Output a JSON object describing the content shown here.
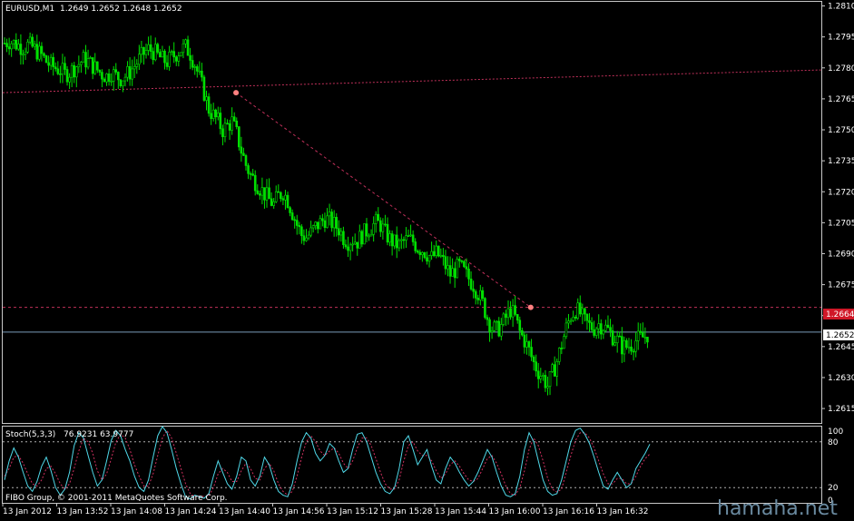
{
  "colors": {
    "background": "#000000",
    "grid": "#c8c8c8",
    "candle": "#00e000",
    "trendline": "#c0305a",
    "hline_red": "#c0305a",
    "hline_blue": "#7a9bb8",
    "stoch_main": "#4fd8e8",
    "stoch_signal": "#d03060",
    "label_red_bg": "#d01828",
    "label_white_bg": "#ffffff",
    "text": "#ffffff",
    "watermark": "#6a8aa0",
    "marker": "#ff8080"
  },
  "header": {
    "symbol": "EURUSD,M1",
    "ohlc": "1.2649 1.2652 1.2648 1.2652"
  },
  "price_labels": {
    "red_line": "1.2664",
    "current": "1.2652"
  },
  "stoch_header": {
    "name": "Stoch(5,3,3)",
    "values": "76.9231 63.9777"
  },
  "copyright": "FIBO Group, © 2001-2011 MetaQuotes Software Corp.",
  "watermark": "hamaha.net",
  "chart_data": {
    "type": "candlestick",
    "symbol": "EURUSD",
    "timeframe": "M1",
    "y_ticks": [
      "1.2810",
      "1.2795",
      "1.2780",
      "1.2765",
      "1.2750",
      "1.2735",
      "1.2720",
      "1.2705",
      "1.2690",
      "1.2675",
      "1.2660",
      "1.2645",
      "1.2630",
      "1.2615"
    ],
    "ylim": [
      1.2608,
      1.2812
    ],
    "x_ticks": [
      "13 Jan 2012",
      "13 Jan 13:52",
      "13 Jan 14:08",
      "13 Jan 14:24",
      "13 Jan 14:40",
      "13 Jan 14:56",
      "13 Jan 15:12",
      "13 Jan 15:28",
      "13 Jan 15:44",
      "13 Jan 16:00",
      "13 Jan 16:16",
      "13 Jan 16:32"
    ],
    "close_path": [
      1.2792,
      1.2793,
      1.2792,
      1.2791,
      1.279,
      1.2791,
      1.279,
      1.2788,
      1.2786,
      1.2783,
      1.2781,
      1.278,
      1.2779,
      1.2777,
      1.2778,
      1.278,
      1.2782,
      1.2784,
      1.2783,
      1.2781,
      1.2779,
      1.2777,
      1.2776,
      1.2778,
      1.2776,
      1.2775,
      1.2776,
      1.2778,
      1.2781,
      1.2784,
      1.2787,
      1.2789,
      1.2788,
      1.2786,
      1.2784,
      1.2783,
      1.2785,
      1.2787,
      1.2789,
      1.279,
      1.2787,
      1.2782,
      1.2775,
      1.2768,
      1.276,
      1.2757,
      1.2754,
      1.275,
      1.2752,
      1.2754,
      1.2748,
      1.274,
      1.2733,
      1.2728,
      1.2725,
      1.2722,
      1.2719,
      1.2716,
      1.2714,
      1.2718,
      1.272,
      1.2716,
      1.271,
      1.2704,
      1.2699,
      1.2698,
      1.27,
      1.2703,
      1.2705,
      1.2707,
      1.2706,
      1.2704,
      1.2702,
      1.2698,
      1.2696,
      1.2697,
      1.2696,
      1.2699,
      1.2701,
      1.2703,
      1.2705,
      1.2704,
      1.27,
      1.2697,
      1.2695,
      1.2694,
      1.2696,
      1.2697,
      1.2696,
      1.2693,
      1.2692,
      1.269,
      1.2688,
      1.269,
      1.2688,
      1.2684,
      1.268,
      1.2682,
      1.2684,
      1.2681,
      1.2678,
      1.2675,
      1.2671,
      1.2666,
      1.2659,
      1.2654,
      1.2653,
      1.2655,
      1.2659,
      1.2663,
      1.2659,
      1.2652,
      1.2648,
      1.2643,
      1.2637,
      1.2633,
      1.263,
      1.2626,
      1.2632,
      1.2638,
      1.2646,
      1.2654,
      1.266,
      1.2663,
      1.2661,
      1.2657,
      1.2655,
      1.2654,
      1.2656,
      1.2655,
      1.2653,
      1.265,
      1.2648,
      1.2645,
      1.2645,
      1.2646,
      1.2648,
      1.2649,
      1.265,
      1.2652
    ],
    "lines": {
      "hline_red": 1.2664,
      "hline_current": 1.2652,
      "upper_trend": [
        [
          0,
          1.2768
        ],
        [
          1,
          1.2779
        ]
      ],
      "down_trend": [
        [
          0.285,
          1.2768
        ],
        [
          0.645,
          1.2664
        ]
      ]
    },
    "stochastic": {
      "name": "Stoch(5,3,3)",
      "ylim": [
        0,
        100
      ],
      "levels": [
        20,
        80
      ],
      "y_ticks": [
        "100",
        "80",
        "20",
        "0"
      ],
      "main": [
        30,
        55,
        72,
        60,
        40,
        22,
        15,
        28,
        48,
        60,
        42,
        20,
        10,
        18,
        40,
        75,
        92,
        85,
        62,
        40,
        22,
        30,
        55,
        82,
        95,
        88,
        70,
        55,
        35,
        20,
        15,
        30,
        60,
        88,
        100,
        92,
        70,
        45,
        25,
        8,
        5,
        10,
        8,
        6,
        12,
        35,
        55,
        40,
        25,
        18,
        35,
        60,
        55,
        30,
        22,
        35,
        60,
        50,
        30,
        15,
        10,
        8,
        25,
        55,
        80,
        92,
        85,
        65,
        55,
        62,
        78,
        72,
        55,
        40,
        45,
        70,
        90,
        92,
        80,
        60,
        40,
        25,
        15,
        12,
        20,
        45,
        80,
        88,
        70,
        50,
        60,
        70,
        48,
        30,
        25,
        45,
        60,
        52,
        40,
        30,
        22,
        28,
        40,
        55,
        70,
        60,
        40,
        22,
        10,
        8,
        12,
        35,
        70,
        92,
        80,
        55,
        30,
        15,
        10,
        12,
        30,
        55,
        80,
        95,
        98,
        90,
        78,
        60,
        40,
        22,
        18,
        30,
        40,
        30,
        20,
        25,
        45,
        55,
        65,
        77
      ],
      "signal": [
        35,
        45,
        60,
        62,
        52,
        38,
        25,
        22,
        30,
        45,
        48,
        38,
        25,
        18,
        25,
        45,
        68,
        85,
        80,
        65,
        42,
        30,
        38,
        58,
        80,
        90,
        85,
        70,
        50,
        35,
        22,
        22,
        38,
        62,
        85,
        95,
        85,
        65,
        45,
        25,
        12,
        8,
        9,
        8,
        9,
        20,
        38,
        45,
        40,
        28,
        28,
        42,
        52,
        45,
        32,
        30,
        45,
        52,
        42,
        25,
        15,
        10,
        15,
        35,
        60,
        80,
        88,
        80,
        68,
        62,
        68,
        72,
        65,
        52,
        45,
        55,
        72,
        85,
        85,
        75,
        58,
        40,
        25,
        18,
        18,
        30,
        55,
        75,
        80,
        68,
        62,
        62,
        55,
        42,
        32,
        38,
        50,
        55,
        48,
        38,
        30,
        28,
        32,
        45,
        58,
        62,
        52,
        38,
        22,
        12,
        10,
        20,
        42,
        70,
        85,
        75,
        55,
        32,
        18,
        14,
        18,
        40,
        62,
        82,
        92,
        92,
        85,
        72,
        55,
        38,
        25,
        25,
        32,
        32,
        25,
        25,
        35,
        48,
        58,
        64
      ]
    }
  }
}
